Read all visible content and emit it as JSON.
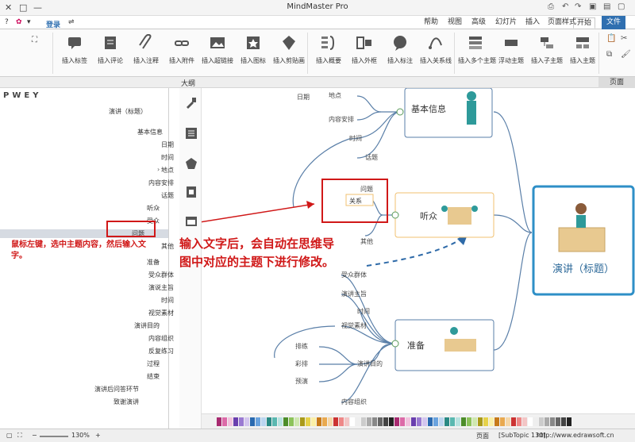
{
  "app": {
    "title": "MindMaster Pro",
    "login": "登录",
    "window_controls": [
      "✕",
      "□",
      "—"
    ]
  },
  "tabs": [
    "文件",
    "开始",
    "页面样式",
    "插入",
    "幻灯片",
    "高级",
    "视图",
    "帮助"
  ],
  "ribbon": {
    "buttons": [
      "插入主题",
      "插入子主题",
      "浮动主题",
      "插入多个主题",
      "插入关系线",
      "插入标注",
      "插入外框",
      "插入概要",
      "插入剪贴画",
      "插入图标",
      "插入超链接",
      "插入附件",
      "插入注释",
      "插入评论",
      "插入标签"
    ]
  },
  "panel": {
    "outline_title": "大纲",
    "page_tab": "页面",
    "outline_toolbar": "PWEY"
  },
  "outline": {
    "items": [
      "演讲（标题）",
      "基本信息",
      "日期",
      "时间",
      "地点",
      "内容安排",
      "话题",
      "听众",
      "受众",
      "问题",
      "其他",
      "准备",
      "受众群体",
      "演说主旨",
      "时间",
      "视觉素材",
      "演讲目的",
      "内容组织",
      "反复练习",
      "过程",
      "结束",
      "演讲后问答环节",
      "致谢演讲"
    ],
    "selected_index": 9
  },
  "canvas": {
    "central_topic": "演讲（标题）",
    "main_topics": [
      "基本信息",
      "听众",
      "准备"
    ],
    "subtopics_basic": [
      "地点",
      "内容安排",
      "时间",
      "日期",
      "话题"
    ],
    "subtopics_audience": [
      "问题",
      "其他"
    ],
    "subtopics_prep": [
      "受众群体",
      "演讲主旨",
      "时间",
      "视觉素材",
      "演讲目的",
      "内容组织"
    ],
    "subtopics_prep2": [
      "排练",
      "彩排",
      "预演"
    ],
    "editing_box": "关系"
  },
  "annotations": {
    "left": "鼠标左键，选中主题内容，然后输入文字。",
    "center": "输入文字后，会自动在思维导图中对应的主题下进行修改。"
  },
  "status": {
    "url": "http://www.edrawsoft.cn",
    "topic": "[SubTopic 130]",
    "zoom": "130%",
    "page": "页面"
  },
  "colors": {
    "file_tab": "#2f6fb0",
    "annotation_red": "#d01818",
    "topic_blue": "#2e8fc7",
    "audience_orange": "#f0c070"
  }
}
